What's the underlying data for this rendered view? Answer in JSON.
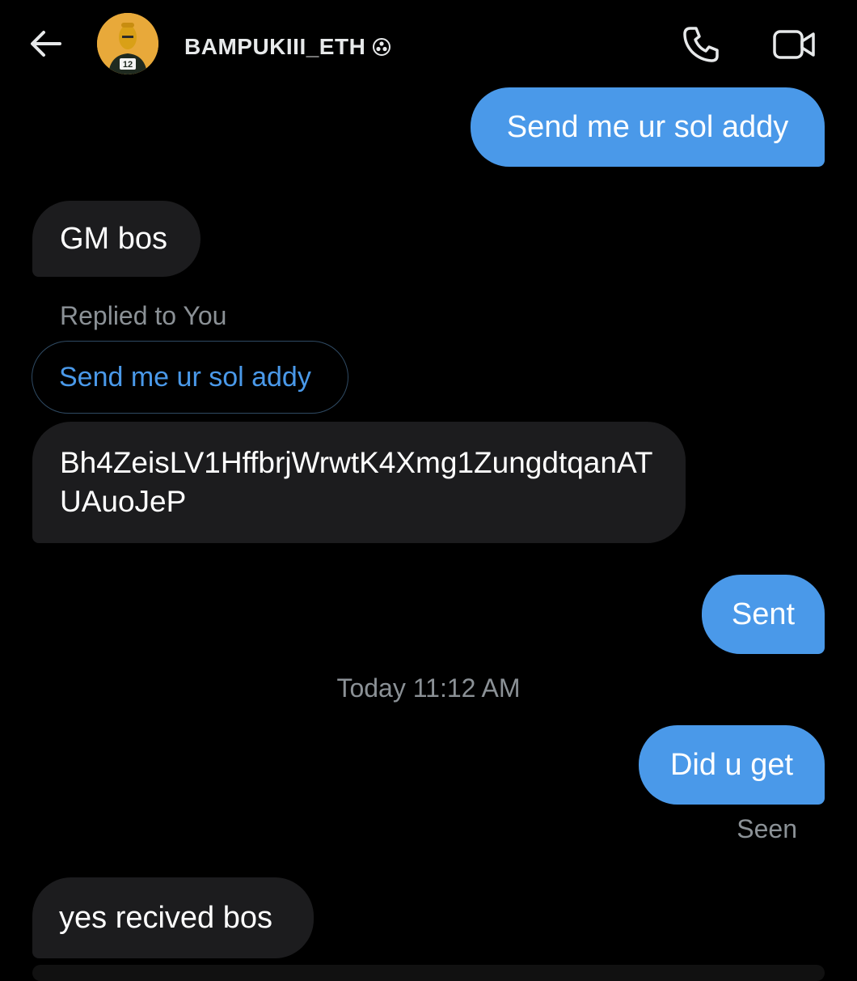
{
  "header": {
    "back_icon": "arrow-left-icon",
    "username": "BAMPUKIII_ETH",
    "badge_icon": "verified-badge-icon",
    "phone_icon": "phone-icon",
    "video_icon": "video-camera-icon"
  },
  "messages": [
    {
      "direction": "out",
      "text": "Send me ur sol addy"
    },
    {
      "direction": "in",
      "text": "GM bos"
    },
    {
      "direction": "in",
      "replied_label": "Replied to You",
      "reply_quote": "Send me ur sol addy",
      "text": "Bh4ZeisLV1HffbrjWrwtK4Xmg1ZungdtqanATUAuoJeP"
    },
    {
      "direction": "out",
      "text": "Sent"
    },
    {
      "timestamp": "Today 11:12 AM"
    },
    {
      "direction": "out",
      "text": "Did u get",
      "status": "Seen"
    },
    {
      "direction": "in",
      "text": "yes recived bos"
    }
  ],
  "colors": {
    "background": "#000000",
    "outgoing_bubble": "#4a99e9",
    "incoming_bubble": "#1c1c1e",
    "muted_text": "#8b9196",
    "accent": "#4a99e9"
  }
}
